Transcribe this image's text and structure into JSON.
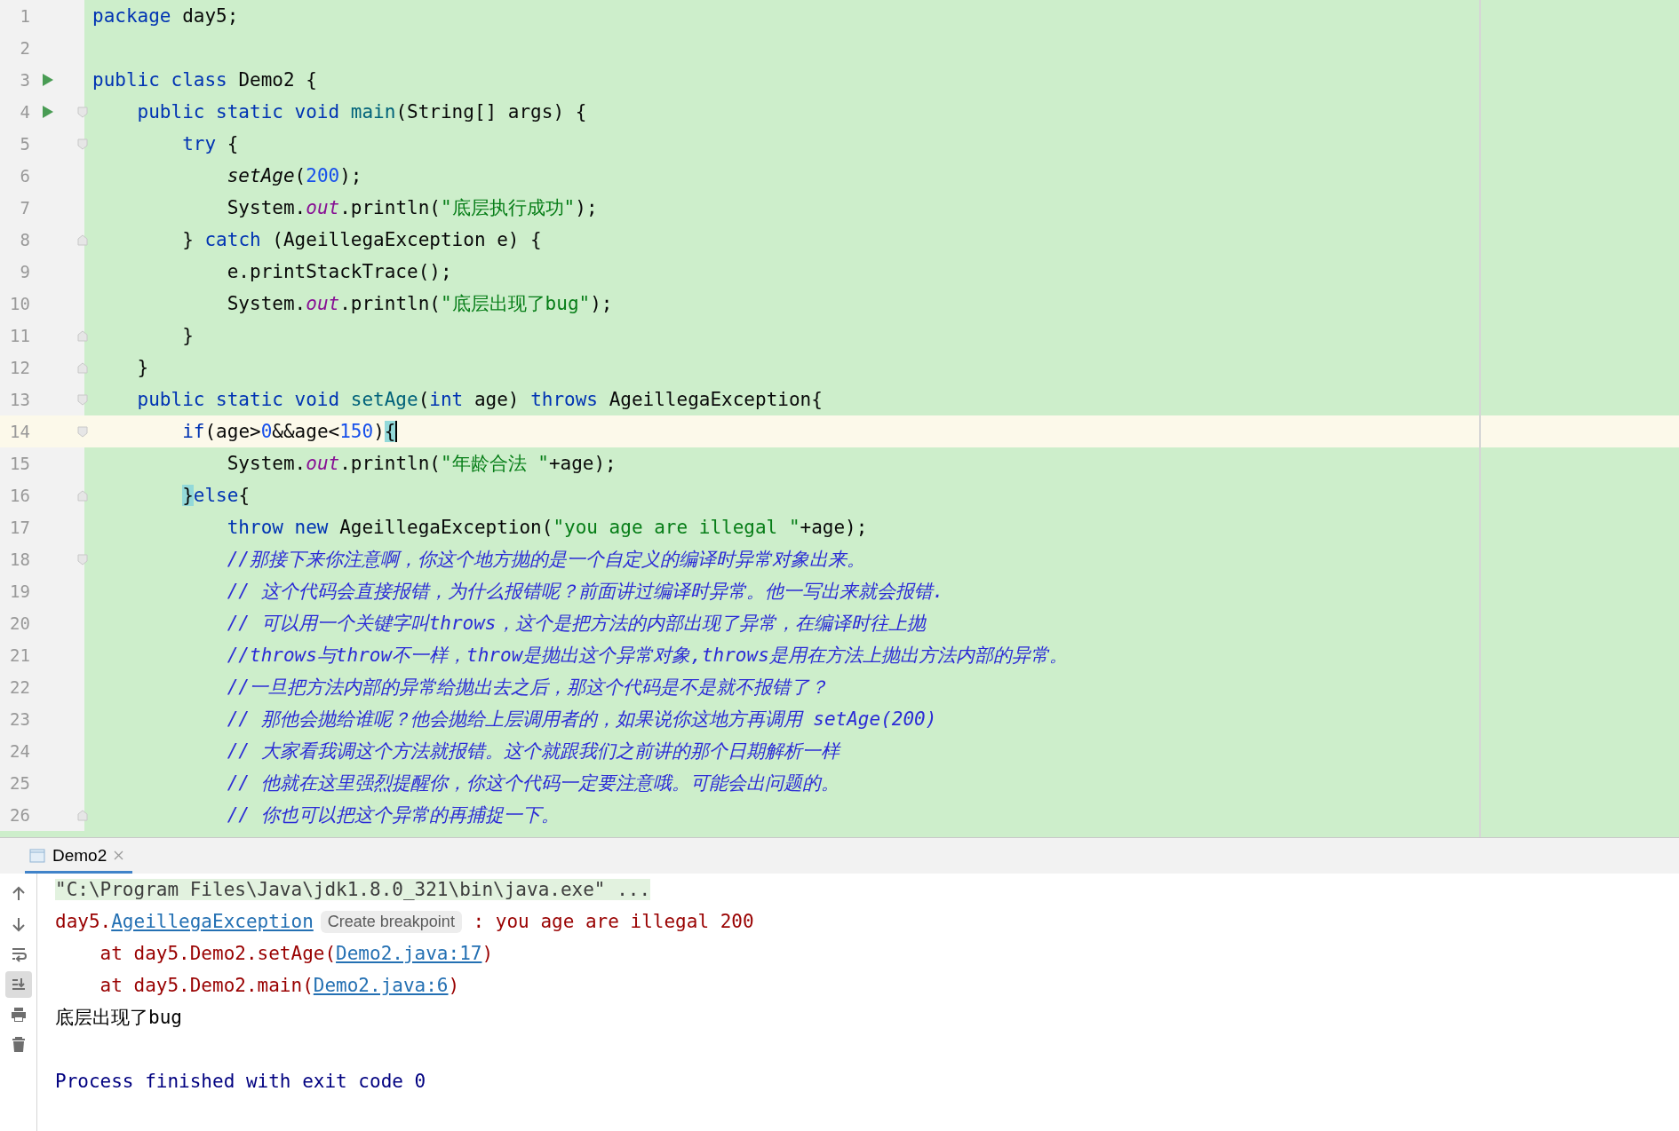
{
  "editor": {
    "lines": [
      {
        "number": "1",
        "tokens": [
          {
            "kind": "keyword",
            "text": "package"
          },
          {
            "kind": "plain",
            "text": " day5;"
          }
        ]
      },
      {
        "number": "2"
      },
      {
        "number": "3",
        "run": true,
        "tokens": [
          {
            "kind": "keyword",
            "text": "public class"
          },
          {
            "kind": "plain",
            "text": " Demo2 {"
          }
        ]
      },
      {
        "number": "4",
        "run": true,
        "fold_start": true,
        "tokens": [
          {
            "kind": "keyword",
            "text": "    public static void "
          },
          {
            "kind": "method",
            "text": "main"
          },
          {
            "kind": "plain",
            "text": "(String[] args) {"
          }
        ]
      },
      {
        "number": "5",
        "fold_start": true,
        "tokens": [
          {
            "kind": "keyword",
            "text": "        try"
          },
          {
            "kind": "plain",
            "text": " {"
          }
        ]
      },
      {
        "number": "6",
        "tokens": [
          {
            "kind": "static-call",
            "text": "            setAge"
          },
          {
            "kind": "plain",
            "text": "("
          },
          {
            "kind": "number",
            "text": "200"
          },
          {
            "kind": "plain",
            "text": ");"
          }
        ]
      },
      {
        "number": "7",
        "tokens": [
          {
            "kind": "plain",
            "text": "            System."
          },
          {
            "kind": "field",
            "text": "out"
          },
          {
            "kind": "plain",
            "text": ".println("
          },
          {
            "kind": "string",
            "text": "\"底层执行成功\""
          },
          {
            "kind": "plain",
            "text": ");"
          }
        ]
      },
      {
        "number": "8",
        "fold_end": true,
        "tokens": [
          {
            "kind": "plain",
            "text": "        } "
          },
          {
            "kind": "keyword",
            "text": "catch"
          },
          {
            "kind": "plain",
            "text": " (AgeillegaException e) {"
          }
        ]
      },
      {
        "number": "9",
        "tokens": [
          {
            "kind": "plain",
            "text": "            e.printStackTrace();"
          }
        ]
      },
      {
        "number": "10",
        "tokens": [
          {
            "kind": "plain",
            "text": "            System."
          },
          {
            "kind": "field",
            "text": "out"
          },
          {
            "kind": "plain",
            "text": ".println("
          },
          {
            "kind": "string",
            "text": "\"底层出现了bug\""
          },
          {
            "kind": "plain",
            "text": ");"
          }
        ]
      },
      {
        "number": "11",
        "fold_end": true,
        "tokens": [
          {
            "kind": "plain",
            "text": "        }"
          }
        ]
      },
      {
        "number": "12",
        "fold_end": true,
        "tokens": [
          {
            "kind": "plain",
            "text": "    }"
          }
        ]
      },
      {
        "number": "13",
        "fold_start": true,
        "tokens": [
          {
            "kind": "keyword",
            "text": "    public static void "
          },
          {
            "kind": "method",
            "text": "setAge"
          },
          {
            "kind": "plain",
            "text": "("
          },
          {
            "kind": "keyword",
            "text": "int"
          },
          {
            "kind": "plain",
            "text": " age) "
          },
          {
            "kind": "keyword",
            "text": "throws"
          },
          {
            "kind": "plain",
            "text": " AgeillegaException{"
          }
        ]
      },
      {
        "number": "14",
        "current": true,
        "fold_start": true,
        "tokens": [
          {
            "kind": "keyword",
            "text": "        if"
          },
          {
            "kind": "plain",
            "text": "(age>"
          },
          {
            "kind": "number",
            "text": "0"
          },
          {
            "kind": "plain",
            "text": "&&age<"
          },
          {
            "kind": "number",
            "text": "150"
          },
          {
            "kind": "plain",
            "text": ")"
          },
          {
            "kind": "brace-match",
            "text": "{"
          }
        ]
      },
      {
        "number": "15",
        "tokens": [
          {
            "kind": "plain",
            "text": "            System."
          },
          {
            "kind": "field",
            "text": "out"
          },
          {
            "kind": "plain",
            "text": ".println("
          },
          {
            "kind": "string",
            "text": "\"年龄合法 \""
          },
          {
            "kind": "plain",
            "text": "+age);"
          }
        ]
      },
      {
        "number": "16",
        "fold_end": true,
        "tokens": [
          {
            "kind": "brace-match",
            "text": "        }"
          },
          {
            "kind": "keyword",
            "text": "else"
          },
          {
            "kind": "plain",
            "text": "{"
          }
        ]
      },
      {
        "number": "17",
        "tokens": [
          {
            "kind": "keyword",
            "text": "            throw new"
          },
          {
            "kind": "plain",
            "text": " AgeillegaException("
          },
          {
            "kind": "string",
            "text": "\"you age are illegal \""
          },
          {
            "kind": "plain",
            "text": "+age);"
          }
        ]
      },
      {
        "number": "18",
        "fold_start": true,
        "tokens": [
          {
            "kind": "comment",
            "text": "            //那接下来你注意啊，你这个地方抛的是一个自定义的编译时异常对象出来。"
          }
        ]
      },
      {
        "number": "19",
        "tokens": [
          {
            "kind": "comment",
            "text": "            // 这个代码会直接报错，为什么报错呢？前面讲过编译时异常。他一写出来就会报错."
          }
        ]
      },
      {
        "number": "20",
        "tokens": [
          {
            "kind": "comment",
            "text": "            // 可以用一个关键字叫throws，这个是把方法的内部出现了异常，在编译时往上抛"
          }
        ]
      },
      {
        "number": "21",
        "tokens": [
          {
            "kind": "comment",
            "text": "            //throws与throw不一样，throw是抛出这个异常对象,throws是用在方法上抛出方法内部的异常。"
          }
        ]
      },
      {
        "number": "22",
        "tokens": [
          {
            "kind": "comment",
            "text": "            //一旦把方法内部的异常给抛出去之后，那这个代码是不是就不报错了？"
          }
        ]
      },
      {
        "number": "23",
        "tokens": [
          {
            "kind": "comment",
            "text": "            // 那他会抛给谁呢？他会抛给上层调用者的，如果说你这地方再调用 setAge(200)"
          }
        ]
      },
      {
        "number": "24",
        "tokens": [
          {
            "kind": "comment",
            "text": "            // 大家看我调这个方法就报错。这个就跟我们之前讲的那个日期解析一样"
          }
        ]
      },
      {
        "number": "25",
        "tokens": [
          {
            "kind": "comment",
            "text": "            // 他就在这里强烈提醒你，你这个代码一定要注意哦。可能会出问题的。"
          }
        ]
      },
      {
        "number": "26",
        "fold_end": true,
        "tokens": [
          {
            "kind": "comment",
            "text": "            // 你也可以把这个异常的再捕捉一下。"
          }
        ]
      }
    ]
  },
  "run_panel": {
    "tabs": [
      {
        "label": "Demo2",
        "selected": true
      }
    ],
    "toolbar": [
      {
        "kind": "up",
        "on": false
      },
      {
        "kind": "down",
        "on": false
      },
      {
        "kind": "wrap",
        "on": false
      },
      {
        "kind": "scroll-end",
        "on": true
      },
      {
        "kind": "print",
        "on": false
      },
      {
        "kind": "delete",
        "on": false
      }
    ],
    "lines": [
      {
        "kind": "command",
        "parts": [
          {
            "kind": "gray",
            "text": "\"C:\\Program Files\\Java\\jdk1.8.0_321\\bin\\java.exe\" ..."
          }
        ]
      },
      {
        "kind": "error",
        "parts": [
          {
            "kind": "error",
            "text": "day5."
          },
          {
            "kind": "link",
            "text": "AgeillegaException"
          },
          {
            "kind": "hint",
            "text": "Create breakpoint"
          },
          {
            "kind": "error",
            "text": " : you age are illegal 200"
          }
        ]
      },
      {
        "kind": "error",
        "parts": [
          {
            "kind": "error",
            "text": "    at day5.Demo2.setAge("
          },
          {
            "kind": "link",
            "text": "Demo2.java:17"
          },
          {
            "kind": "error",
            "text": ")"
          }
        ]
      },
      {
        "kind": "error",
        "parts": [
          {
            "kind": "error",
            "text": "    at day5.Demo2.main("
          },
          {
            "kind": "link",
            "text": "Demo2.java:6"
          },
          {
            "kind": "error",
            "text": ")"
          }
        ]
      },
      {
        "kind": "output",
        "parts": [
          {
            "kind": "plain",
            "text": "底层出现了bug"
          }
        ]
      },
      {
        "kind": "blank"
      },
      {
        "kind": "system",
        "parts": [
          {
            "kind": "system",
            "text": "Process finished with exit code 0"
          }
        ]
      }
    ]
  }
}
